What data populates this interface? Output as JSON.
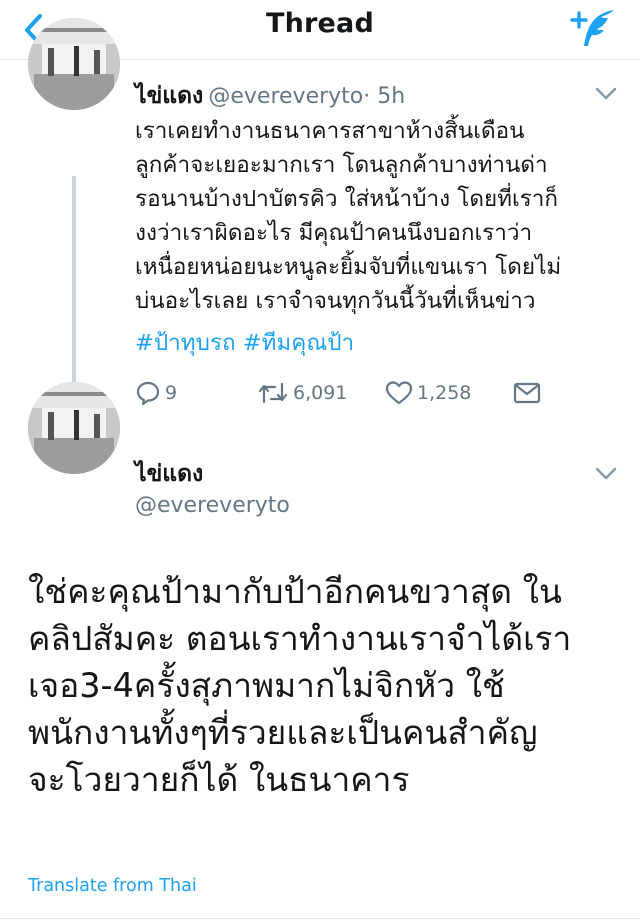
{
  "header": {
    "title": "Thread",
    "back_icon": "chevron-left-icon",
    "compose_icon": "compose-tweet-icon",
    "accent": "#1da1f2"
  },
  "tweet1": {
    "name": "ไข่แดง",
    "handle": "@evereveryto",
    "time": "· 5h",
    "body": "เราเคยทำงานธนาคารสาขาห้างสิ้นเดือน\nลูกค้าจะเยอะมากเรา โดนลูกค้าบางท่านด่า\nรอนานบ้างปาบัตรคิว ใส่หน้าบ้าง โดยที่เราก็\nงงว่าเราผิดอะไร มีคุณป้าคนนึงบอกเราว่า\nเหนื่อยหน่อยนะหนูละยิ้มจับที่แขนเรา โดยไม่\nบ่นอะไรเลย เราจำจนทุกวันนี้วันที่เห็นข่าว",
    "hashtags": [
      "#ป้าทุบรถ",
      "#ทีมคุณป้า"
    ],
    "replies": "9",
    "retweets": "6,091",
    "likes": "1,258"
  },
  "tweet2": {
    "name": "ไข่แดง",
    "handle": "@evereveryto",
    "body": "ใช่คะคุณป้ามากับป้าอีกคนขวาสุด ใน\nคลิปสัมคะ ตอนเราทำงานเราจำได้เรา\nเจอ3-4ครั้งสุภาพมากไม่จิกหัว ใช้\nพนักงานทั้งๆที่รวยและเป็นคนสำคัญ\nจะโวยวายก็ได้ ในธนาคาร",
    "translate": "Translate from Thai"
  },
  "colors": {
    "text": "#14171a",
    "secondary": "#657786",
    "link": "#1da1f2",
    "divider": "#e1e8ed"
  }
}
